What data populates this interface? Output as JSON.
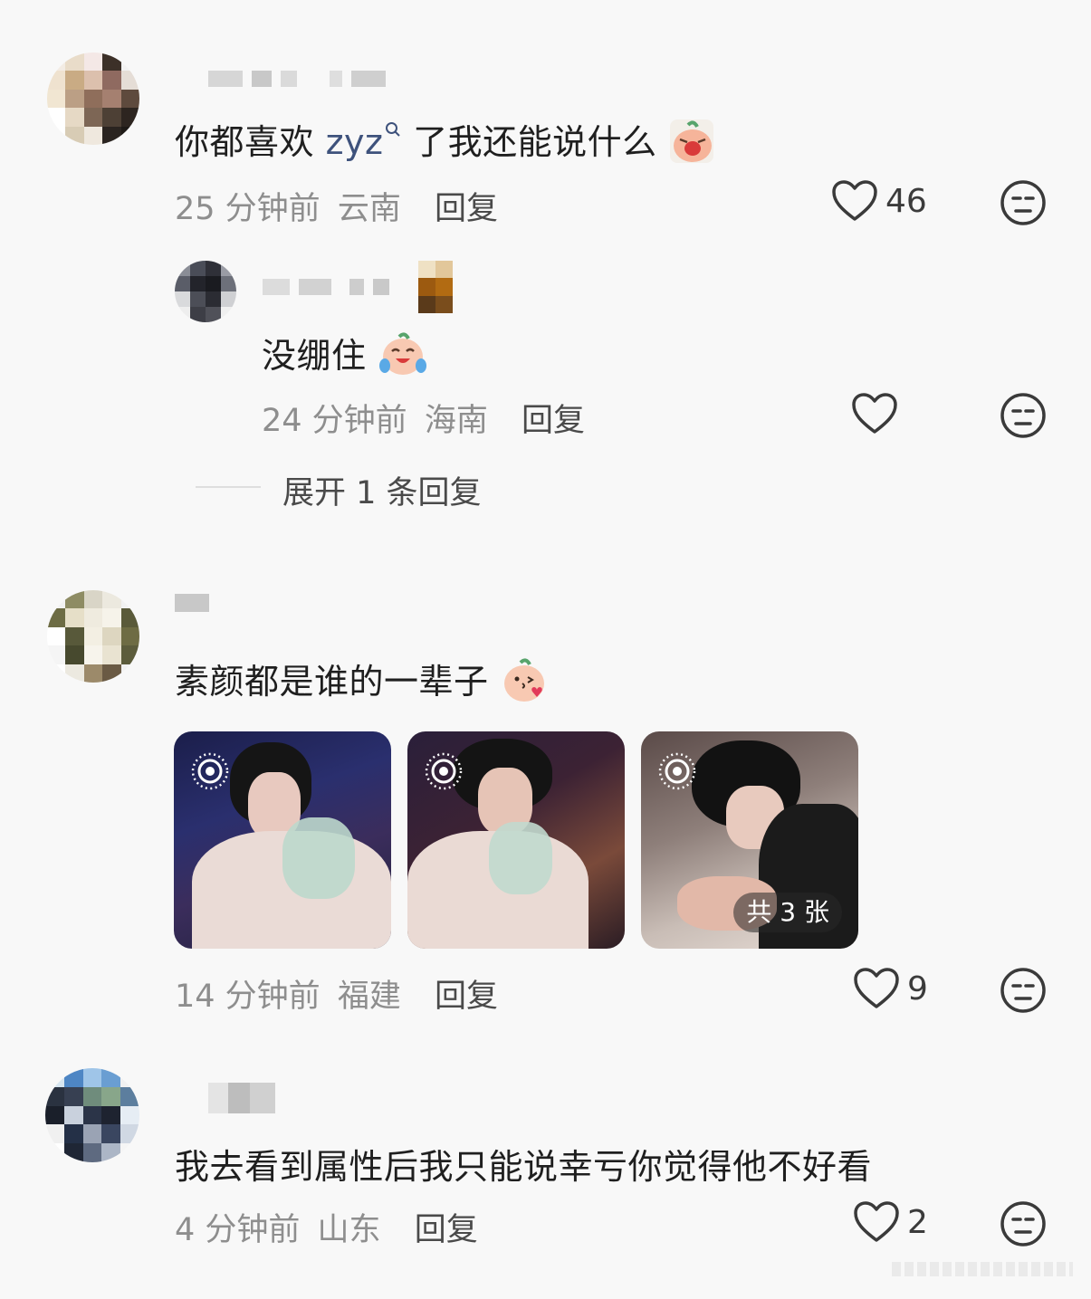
{
  "comments": [
    {
      "text_before": "你都喜欢 ",
      "link": "zyz",
      "text_after": " 了我还能说什么",
      "emoji": "crying-face-emoji",
      "time": "25 分钟前",
      "location": "云南",
      "reply_label": "回复",
      "likes": "46",
      "reply": {
        "text": "没绷住",
        "emoji": "laughing-tears-emoji",
        "time": "24 分钟前",
        "location": "海南",
        "reply_label": "回复"
      },
      "expand_label": "展开 1 条回复"
    },
    {
      "text": "素颜都是谁的一辈子",
      "emoji": "kiss-emoji",
      "time": "14 分钟前",
      "location": "福建",
      "reply_label": "回复",
      "likes": "9",
      "images_badge": "共 3 张"
    },
    {
      "text": "我去看到属性后我只能说幸亏你觉得他不好看",
      "time": "4 分钟前",
      "location": "山东",
      "reply_label": "回复",
      "likes": "2"
    }
  ],
  "colors": {
    "background": "#f8f8f8",
    "link": "#3e527c",
    "meta": "#8e8e8e"
  }
}
